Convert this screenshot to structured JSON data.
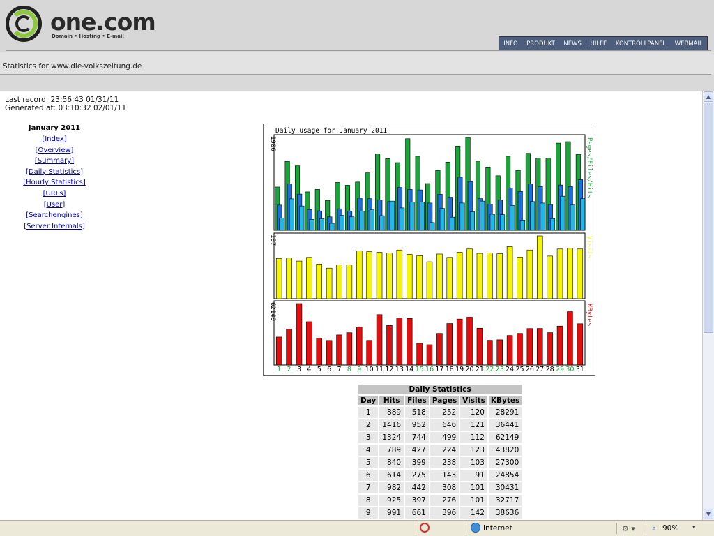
{
  "brand": {
    "name": "one.com",
    "tagline": "Domain • Hosting • E-mail"
  },
  "nav": {
    "items": [
      "INFO",
      "PRODUKT",
      "NEWS",
      "HILFE",
      "KONTROLLPANEL",
      "WEBMAIL"
    ]
  },
  "stats_title": "Statistics for www.die-volkszeitung.de",
  "last_record": "Last record: 23:56:43 01/31/11",
  "generated_at": "Generated at: 03:10:32 02/01/11",
  "sidebar": {
    "title": "January 2011",
    "links": [
      "[Index]",
      "[Overview]",
      "[Summary]",
      "[Daily Statistics]",
      "[Hourly Statistics]",
      "[URLs]",
      "[User]",
      "[Searchengines]",
      "[Server Internals]"
    ]
  },
  "chart_data": {
    "type": "bar",
    "title": "Daily usage for January 2011",
    "categories": [
      "1",
      "2",
      "3",
      "4",
      "5",
      "6",
      "7",
      "8",
      "9",
      "10",
      "11",
      "12",
      "13",
      "14",
      "15",
      "16",
      "17",
      "18",
      "19",
      "20",
      "21",
      "22",
      "23",
      "24",
      "25",
      "26",
      "27",
      "28",
      "29",
      "30",
      "31"
    ],
    "weekend_days": [
      "1",
      "2",
      "8",
      "9",
      "15",
      "16",
      "22",
      "23",
      "29",
      "30"
    ],
    "colors": {
      "hits": "#1aa53b",
      "files": "#1e6fd9",
      "pages": "#22b8e6",
      "visits": "#f5f50a",
      "kbytes": "#e01010",
      "weekend": "#1aa53b",
      "weekday": "#000000"
    },
    "panels": [
      {
        "label": "Pages/Files/Hits",
        "max_label": "1906",
        "ymax": 1906,
        "series": [
          {
            "name": "Hits",
            "values": [
              889,
              1416,
              1324,
              789,
              840,
              614,
              982,
              925,
              991,
              1180,
              1570,
              1470,
              1390,
              1880,
              1520,
              960,
              1230,
              1400,
              1730,
              1906,
              1420,
              1300,
              1120,
              1520,
              1230,
              1580,
              1480,
              1480,
              1790,
              1820,
              1560
            ]
          },
          {
            "name": "Files",
            "values": [
              518,
              952,
              744,
              427,
              399,
              275,
              442,
              397,
              661,
              650,
              620,
              590,
              880,
              840,
              830,
              560,
              740,
              680,
              1090,
              1000,
              650,
              540,
              620,
              870,
              800,
              950,
              900,
              530,
              930,
              900,
              1040
            ]
          },
          {
            "name": "Pages",
            "values": [
              252,
              646,
              499,
              224,
              238,
              143,
              308,
              276,
              396,
              420,
              300,
              600,
              460,
              580,
              580,
              160,
              450,
              270,
              560,
              380,
              600,
              330,
              320,
              510,
              210,
              590,
              560,
              240,
              700,
              520,
              650
            ]
          }
        ]
      },
      {
        "label": "Visits",
        "max_label": "187",
        "ymax": 187,
        "series": [
          {
            "name": "Visits",
            "values": [
              120,
              121,
              112,
              123,
              103,
              91,
              101,
              101,
              142,
              140,
              138,
              136,
              145,
              132,
              128,
              110,
              133,
              123,
              138,
              148,
              135,
              136,
              134,
              155,
              124,
              145,
              187,
              127,
              148,
              150,
              148
            ]
          }
        ]
      },
      {
        "label": "KBytes",
        "max_label": "62149",
        "ymax": 62149,
        "series": [
          {
            "name": "KBytes",
            "values": [
              28291,
              36441,
              62149,
              43820,
              27300,
              24854,
              30431,
              32717,
              38636,
              24900,
              51000,
              40100,
              47600,
              47100,
              22000,
              20500,
              32000,
              42000,
              46500,
              48400,
              37200,
              25000,
              25500,
              29900,
              32000,
              36900,
              37000,
              32800,
              39400,
              54000,
              41800
            ]
          }
        ]
      }
    ]
  },
  "table": {
    "caption": "Daily Statistics",
    "headers": [
      "Day",
      "Hits",
      "Files",
      "Pages",
      "Visits",
      "KBytes"
    ],
    "rows": [
      [
        "1",
        "889",
        "518",
        "252",
        "120",
        "28291"
      ],
      [
        "2",
        "1416",
        "952",
        "646",
        "121",
        "36441"
      ],
      [
        "3",
        "1324",
        "744",
        "499",
        "112",
        "62149"
      ],
      [
        "4",
        "789",
        "427",
        "224",
        "123",
        "43820"
      ],
      [
        "5",
        "840",
        "399",
        "238",
        "103",
        "27300"
      ],
      [
        "6",
        "614",
        "275",
        "143",
        "91",
        "24854"
      ],
      [
        "7",
        "982",
        "442",
        "308",
        "101",
        "30431"
      ],
      [
        "8",
        "925",
        "397",
        "276",
        "101",
        "32717"
      ],
      [
        "9",
        "991",
        "661",
        "396",
        "142",
        "38636"
      ]
    ]
  },
  "statusbar": {
    "zone": "Internet",
    "zoom": "90%"
  }
}
